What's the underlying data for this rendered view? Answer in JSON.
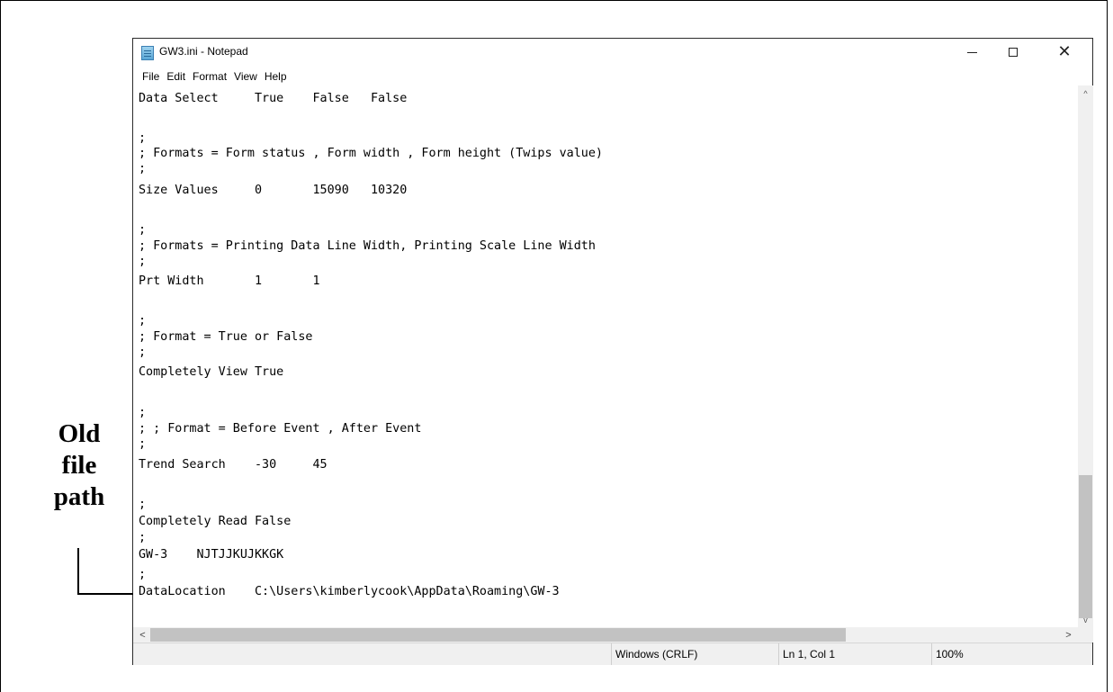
{
  "window": {
    "title": "GW3.ini - Notepad",
    "minimize_icon": "minimize-icon",
    "maximize_icon": "maximize-icon",
    "close_glyph": "✕"
  },
  "menu": [
    "File",
    "Edit",
    "Format",
    "View",
    "Help"
  ],
  "editor_lines": [
    "Data Select     True    False   False",
    "",
    ";",
    "; Formats = Form status , Form width , Form height (Twips value)",
    ";",
    "Size Values     0       15090   10320",
    "",
    ";",
    "; Formats = Printing Data Line Width, Printing Scale Line Width",
    ";",
    "Prt Width       1       1",
    "",
    ";",
    "; Format = True or False",
    ";",
    "Completely View True",
    "",
    ";",
    "; ; Format = Before Event , After Event",
    ";",
    "Trend Search    -30     45",
    "",
    ";",
    "Completely Read False",
    ";",
    "GW-3    NJTJJKUJKKGK",
    ";",
    "DataLocation    C:\\Users\\kimberlycook\\AppData\\Roaming\\GW-3"
  ],
  "scrollbars": {
    "up_glyph": "^",
    "down_glyph": "v",
    "left_glyph": "<",
    "right_glyph": ">"
  },
  "status": {
    "encoding": "Windows (CRLF)",
    "position": "Ln 1, Col 1",
    "zoom": "100%"
  },
  "annotation": {
    "label": "Old\nfile\npath"
  }
}
